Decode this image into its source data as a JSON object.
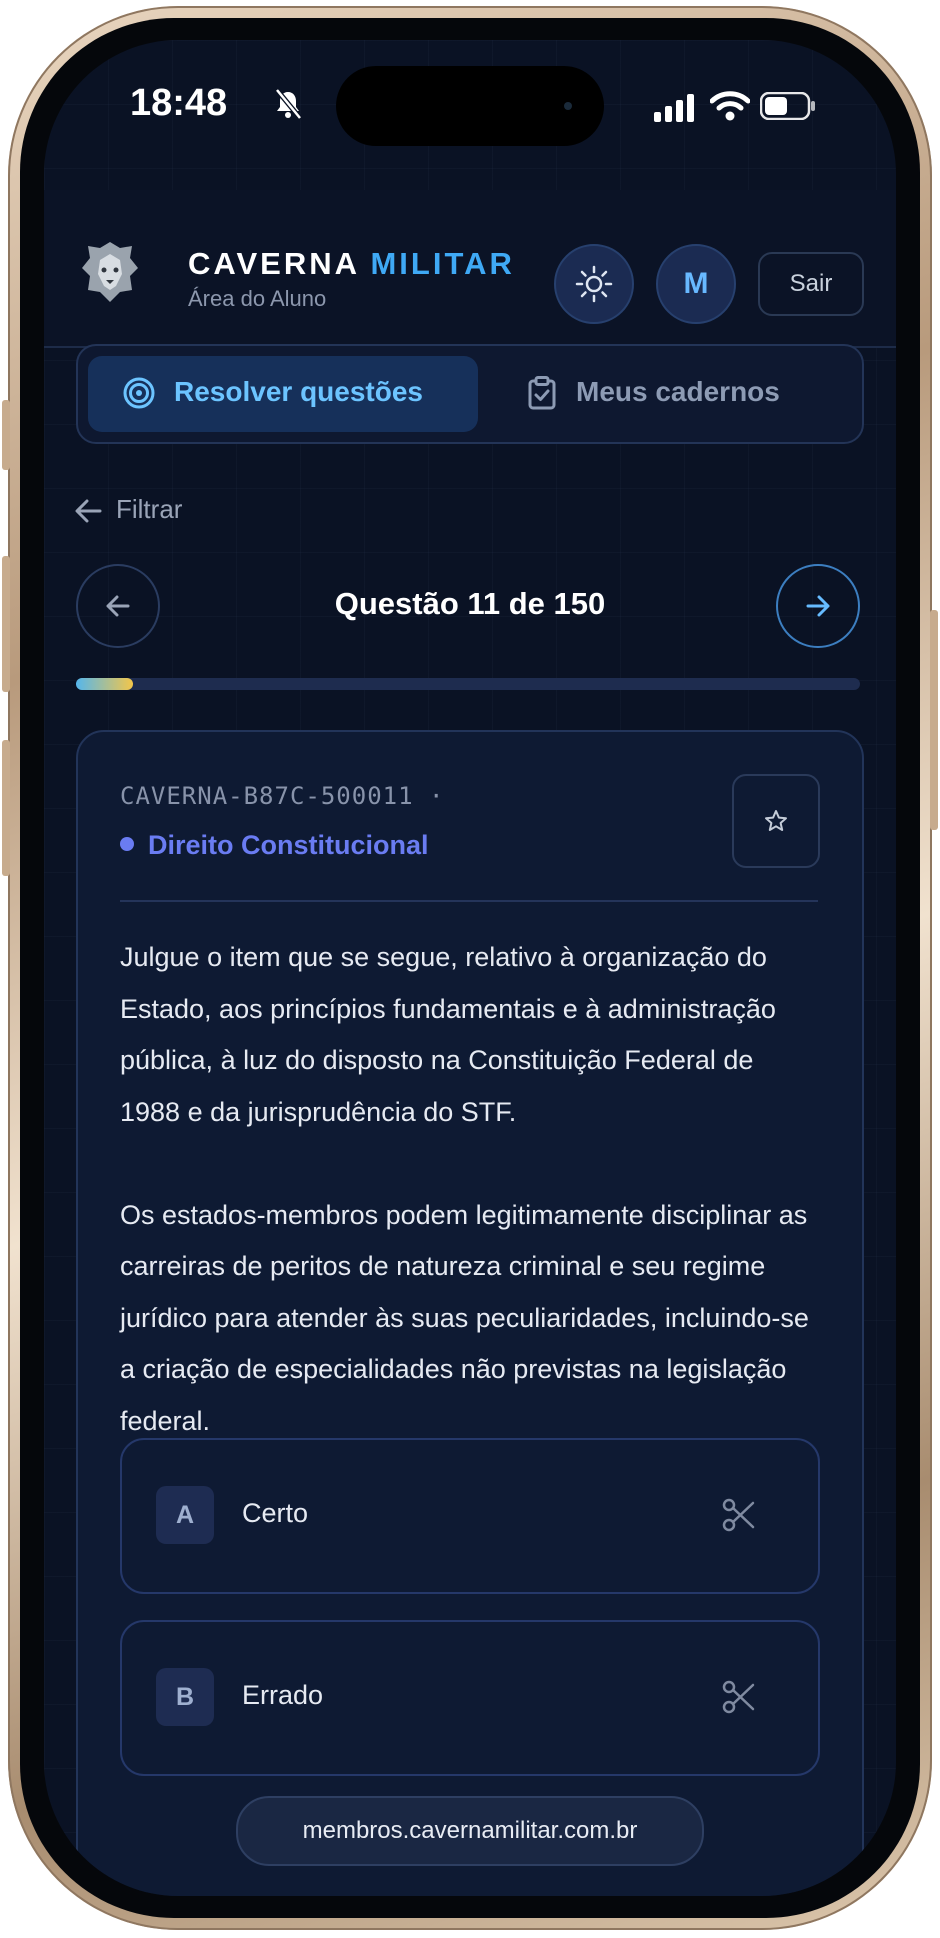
{
  "status_bar": {
    "time": "18:48",
    "icons": [
      "bell-slash-icon",
      "cellular-signal-icon",
      "wifi-icon",
      "battery-icon"
    ]
  },
  "header": {
    "brand_main": "CAVERNA",
    "brand_accent": "MILITAR",
    "subtitle": "Área do Aluno",
    "avatar_initial": "M",
    "logout_label": "Sair",
    "icons": [
      "lion-logo",
      "sun-icon"
    ]
  },
  "tabs": [
    {
      "label": "Resolver questões",
      "icon": "target-icon",
      "active": true
    },
    {
      "label": "Meus cadernos",
      "icon": "clipboard-check-icon",
      "active": false
    }
  ],
  "filter": {
    "label": "Filtrar",
    "icon": "arrow-left-icon"
  },
  "navigation": {
    "title": "Questão 11 de 150",
    "current": 11,
    "total": 150,
    "progress_fraction": 0.0733
  },
  "question": {
    "code": "CAVERNA-B87C-500011 ·",
    "subject": "Direito Constitucional",
    "paragraphs": [
      "Julgue o item que se segue, relativo à organização do Estado, aos princípios fundamentais e à administração pública, à luz do disposto na Constituição Federal de 1988 e da jurisprudência do STF.",
      "Os estados-membros podem legitimamente disciplinar as carreiras de peritos de natureza criminal e seu regime jurídico para atender às suas peculiaridades, incluindo-se a criação de especialidades não previstas na legislação federal."
    ],
    "options": [
      {
        "letter": "A",
        "text": "Certo"
      },
      {
        "letter": "B",
        "text": "Errado"
      }
    ]
  },
  "browser": {
    "url": "membros.cavernamilitar.com.br"
  },
  "colors": {
    "background": "#0a1224",
    "accent_blue": "#3fa9f5",
    "subject_purple": "#6a7cf2",
    "progress_start": "#55b6ec",
    "progress_end": "#f3c64a"
  }
}
